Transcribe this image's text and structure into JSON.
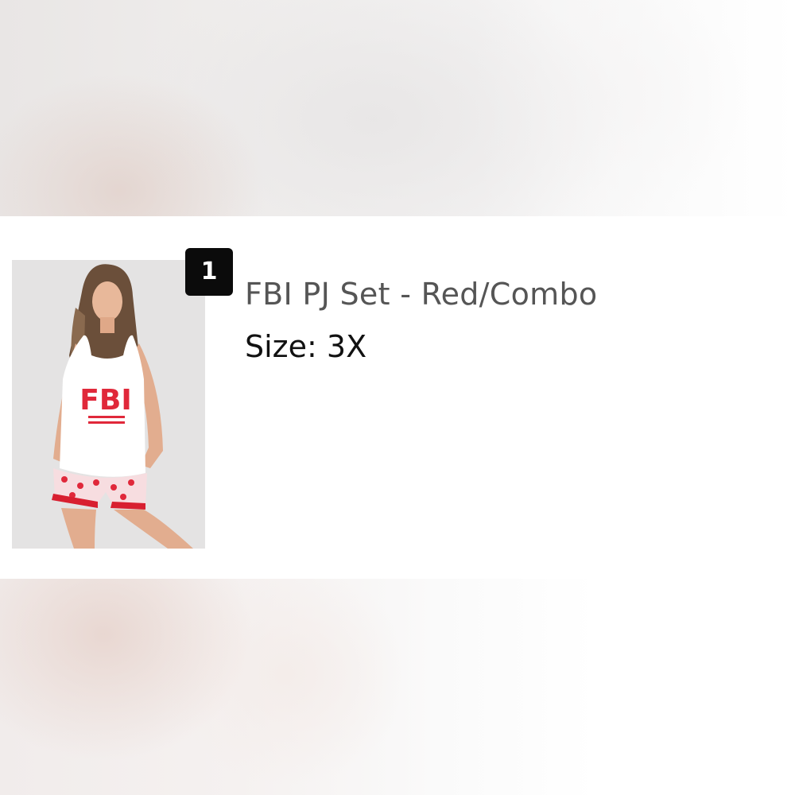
{
  "cart_item": {
    "quantity": "1",
    "title": "FBI PJ Set - Red/Combo",
    "size": "Size: 3X",
    "image": {
      "alt": "FBI PJ Set - Red/Combo",
      "shirt_text": "FBI"
    }
  },
  "colors": {
    "badge_bg": "#0b0b0b",
    "title_text": "#555555",
    "size_text": "#111111",
    "print_red": "#e0283a"
  }
}
